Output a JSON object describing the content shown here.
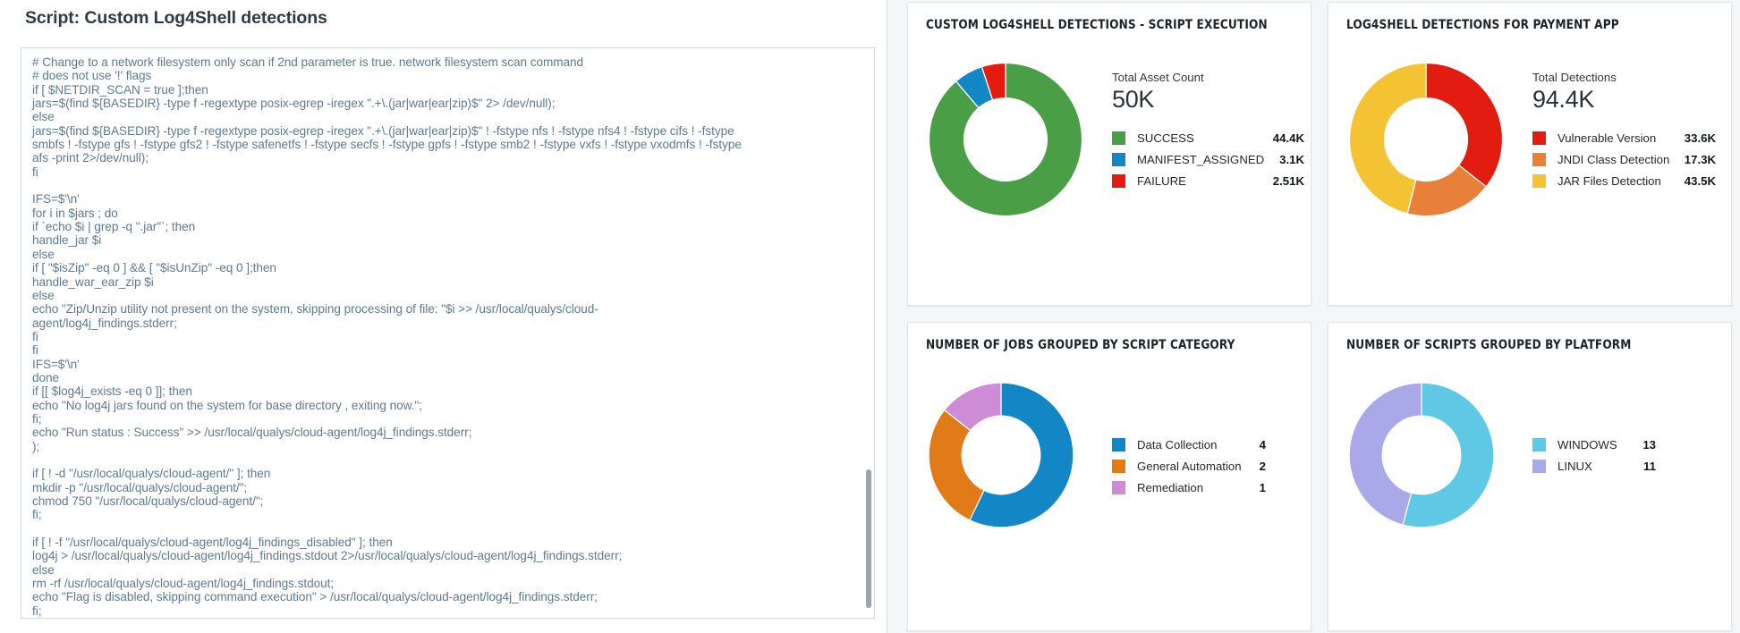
{
  "script_panel": {
    "title": "Script: Custom Log4Shell detections",
    "code": "# Change to a network filesystem only scan if 2nd parameter is true. network filesystem scan command\n# does not use '!' flags\nif [ $NETDIR_SCAN = true ];then\njars=$(find ${BASEDIR} -type f -regextype posix-egrep -iregex \".+\\.(jar|war|ear|zip)$\" 2> /dev/null);\nelse\njars=$(find ${BASEDIR} -type f -regextype posix-egrep -iregex \".+\\.(jar|war|ear|zip)$\" ! -fstype nfs ! -fstype nfs4 ! -fstype cifs ! -fstype\nsmbfs ! -fstype gfs ! -fstype gfs2 ! -fstype safenetfs ! -fstype secfs ! -fstype gpfs ! -fstype smb2 ! -fstype vxfs ! -fstype vxodmfs ! -fstype\nafs -print 2>/dev/null);\nfi\n\nIFS=$'\\n'\nfor i in $jars ; do\nif `echo $i | grep -q \".jar\"`; then\nhandle_jar $i\nelse\nif [ \"$isZip\" -eq 0 ] && [ \"$isUnZip\" -eq 0 ];then\nhandle_war_ear_zip $i\nelse\necho \"Zip/Unzip utility not present on the system, skipping processing of file: \"$i >> /usr/local/qualys/cloud-\nagent/log4j_findings.stderr;\nfi\nfi\nIFS=$'\\n'\ndone\nif [[ $log4j_exists -eq 0 ]]; then\necho \"No log4j jars found on the system for base directory , exiting now.\";\nfi;\necho \"Run status : Success\" >> /usr/local/qualys/cloud-agent/log4j_findings.stderr;\n);\n\nif [ ! -d \"/usr/local/qualys/cloud-agent/\" ]; then\nmkdir -p \"/usr/local/qualys/cloud-agent/\";\nchmod 750 \"/usr/local/qualys/cloud-agent/\";\nfi;\n\nif [ ! -f \"/usr/local/qualys/cloud-agent/log4j_findings_disabled\" ]; then\nlog4j > /usr/local/qualys/cloud-agent/log4j_findings.stdout 2>/usr/local/qualys/cloud-agent/log4j_findings.stderr;\nelse\nrm -rf /usr/local/qualys/cloud-agent/log4j_findings.stdout;\necho \"Flag is disabled, skipping command execution\" > /usr/local/qualys/cloud-agent/log4j_findings.stderr;\nfi;"
  },
  "cards": [
    {
      "title": "CUSTOM LOG4SHELL DETECTIONS - SCRIPT EXECUTION",
      "total_label": "Total Asset Count",
      "total_value": "50K"
    },
    {
      "title": "LOG4SHELL DETECTIONS FOR PAYMENT APP",
      "total_label": "Total Detections",
      "total_value": "94.4K"
    },
    {
      "title": "NUMBER OF JOBS GROUPED BY SCRIPT CATEGORY",
      "total_label": "",
      "total_value": ""
    },
    {
      "title": "NUMBER OF SCRIPTS GROUPED BY PLATFORM",
      "total_label": "",
      "total_value": ""
    }
  ],
  "chart_data": [
    {
      "type": "pie",
      "title": "CUSTOM LOG4SHELL DETECTIONS - SCRIPT EXECUTION",
      "subtitle": "Total Asset Count",
      "total": "50K",
      "categories": [
        "SUCCESS",
        "MANIFEST_ASSIGNED",
        "FAILURE"
      ],
      "values": [
        44400,
        3100,
        2510
      ],
      "value_labels": [
        "44.4K",
        "3.1K",
        "2.51K"
      ],
      "colors": [
        "#4a9e46",
        "#1386c6",
        "#e31c11"
      ],
      "legend_position": "right",
      "donut": true
    },
    {
      "type": "pie",
      "title": "LOG4SHELL DETECTIONS FOR PAYMENT APP",
      "subtitle": "Total Detections",
      "total": "94.4K",
      "categories": [
        "Vulnerable Version",
        "JNDI Class Detection",
        "JAR Files Detection"
      ],
      "values": [
        33600,
        17300,
        43500
      ],
      "value_labels": [
        "33.6K",
        "17.3K",
        "43.5K"
      ],
      "colors": [
        "#e31c11",
        "#e8803a",
        "#f4c333"
      ],
      "legend_position": "right",
      "donut": true
    },
    {
      "type": "pie",
      "title": "NUMBER OF JOBS GROUPED BY SCRIPT CATEGORY",
      "categories": [
        "Data Collection",
        "General Automation",
        "Remediation"
      ],
      "values": [
        4,
        2,
        1
      ],
      "value_labels": [
        "4",
        "2",
        "1"
      ],
      "colors": [
        "#1386c6",
        "#e07b18",
        "#cf8cd6"
      ],
      "legend_position": "right",
      "donut": true
    },
    {
      "type": "pie",
      "title": "NUMBER OF SCRIPTS GROUPED BY PLATFORM",
      "categories": [
        "WINDOWS",
        "LINUX"
      ],
      "values": [
        13,
        11
      ],
      "value_labels": [
        "13",
        "11"
      ],
      "colors": [
        "#5ec8e5",
        "#a9a8e8"
      ],
      "legend_position": "right",
      "donut": true
    }
  ]
}
